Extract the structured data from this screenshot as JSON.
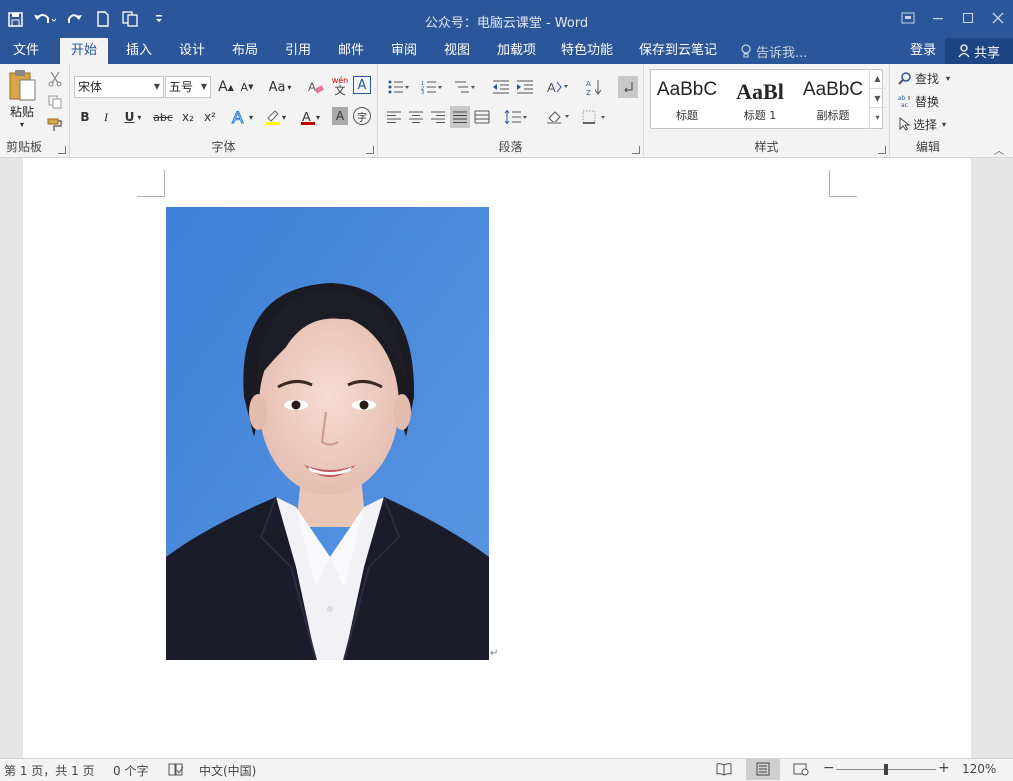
{
  "window": {
    "title": "公众号：电脑云课堂 - Word"
  },
  "tabs": [
    "文件",
    "开始",
    "插入",
    "设计",
    "布局",
    "引用",
    "邮件",
    "审阅",
    "视图",
    "加载项",
    "特色功能",
    "保存到云笔记"
  ],
  "active_tab": "开始",
  "tell_me": "告诉我...",
  "login": "登录",
  "share": "共享",
  "clipboard": {
    "paste": "粘贴",
    "label": "剪贴板"
  },
  "font": {
    "name": "宋体",
    "size": "五号",
    "case_btn": "Aa",
    "label": "字体",
    "bold": "B",
    "italic": "I",
    "underline": "U",
    "strike": "abc",
    "sub": "x₂",
    "sup": "x²",
    "char_border": "A",
    "pinyin_top": "wén",
    "pinyin_bottom": "文",
    "shading": "A",
    "circle": "字"
  },
  "paragraph": {
    "label": "段落"
  },
  "styles": {
    "label": "样式",
    "items": [
      {
        "preview": "AaBbC",
        "name": "标题"
      },
      {
        "preview": "AaBl",
        "name": "标题 1"
      },
      {
        "preview": "AaBbC",
        "name": "副标题"
      }
    ]
  },
  "editing": {
    "label": "编辑",
    "find": "查找",
    "replace": "替换",
    "select": "选择"
  },
  "statusbar": {
    "page": "第 1 页，共 1 页",
    "words": "0 个字",
    "lang": "中文(中国)",
    "zoom": "120%",
    "zoom_level": 0.6
  },
  "colors": {
    "accent": "#2b579a",
    "font_color": "#c00000",
    "highlight": "#ffff00",
    "photo_bg": "#4a8ad8"
  }
}
